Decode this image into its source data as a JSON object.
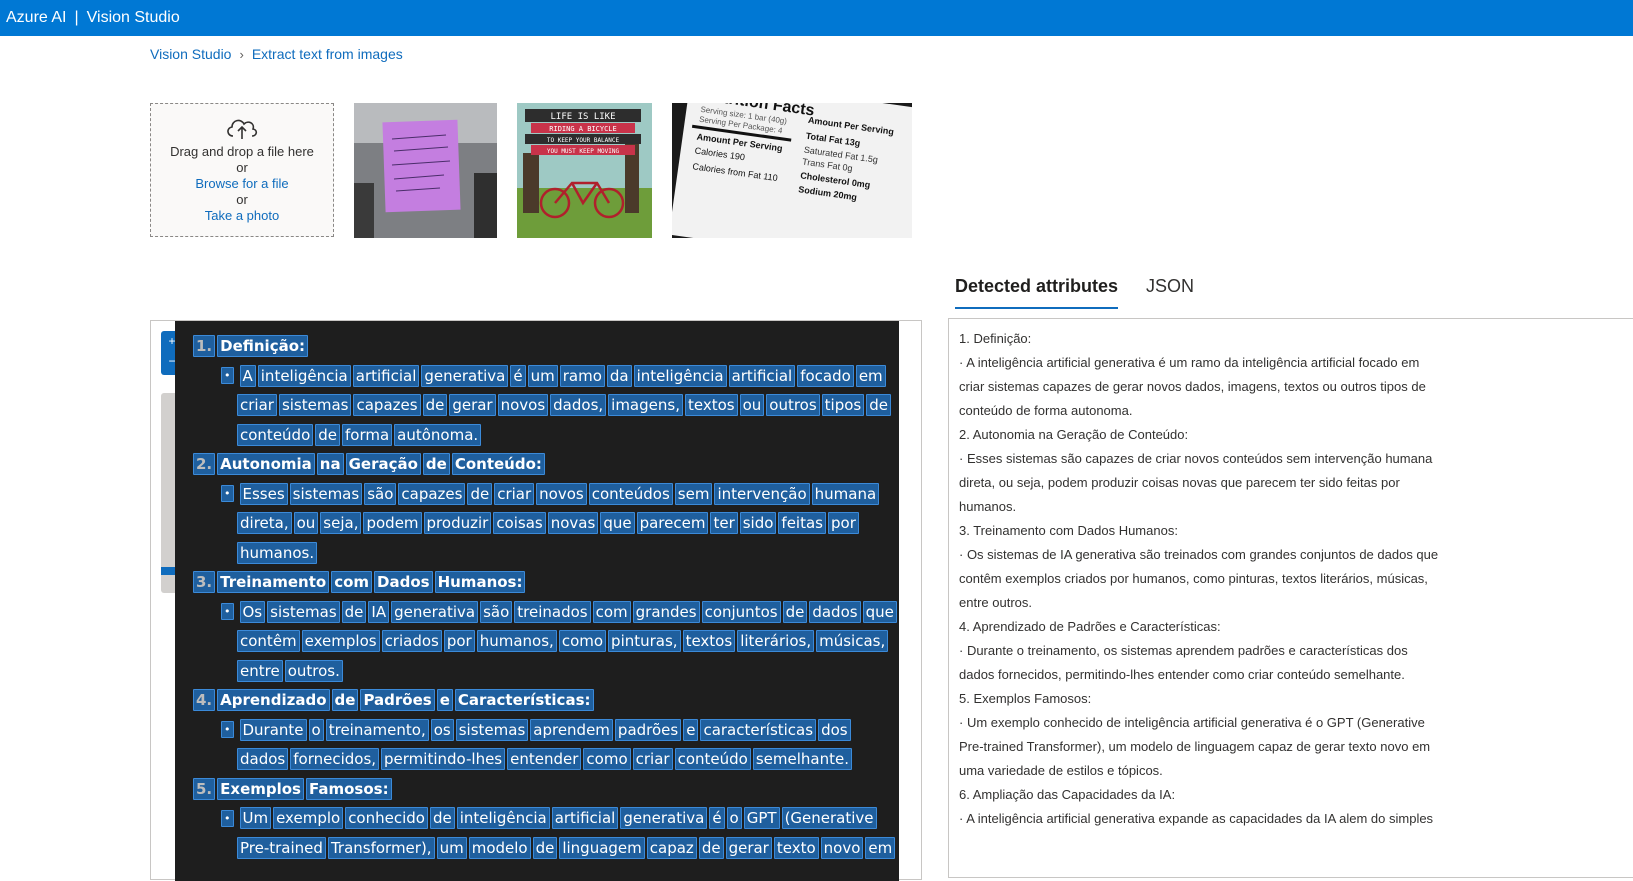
{
  "header": {
    "brand": "Azure AI",
    "separator": "|",
    "product": "Vision Studio"
  },
  "breadcrumb": {
    "items": [
      "Vision Studio",
      "Extract text from images"
    ]
  },
  "upload": {
    "drag_text": "Drag and drop a file here",
    "or1": "or",
    "browse_label": "Browse for a file",
    "or2": "or",
    "photo_label": "Take a photo"
  },
  "samples": {
    "bicycle_lines": [
      "LIFE IS LIKE",
      "RIDING A BICYCLE",
      "TO KEEP YOUR BALANCE",
      "YOU MUST KEEP MOVING"
    ],
    "nutrition_lines": [
      "Nutrition Facts",
      "Serving size: 1 bar (40g)",
      "Serving Per Package: 4",
      "Amount Per Serving",
      "Calories 190",
      "Calories from Fat 110",
      "Total Fat 13g",
      "Saturated Fat 1.5g",
      "Trans Fat 0g",
      "Cholesterol 0mg",
      "Sodium 20mg"
    ]
  },
  "tabs": {
    "detected": "Detected attributes",
    "json": "JSON"
  },
  "viewer": {
    "zoom_in": "+",
    "zoom_out": "−",
    "lines": [
      {
        "type": "heading",
        "num": "1.",
        "words": [
          "Definição:"
        ]
      },
      {
        "type": "bullet",
        "words": [
          "A",
          "inteligência",
          "artificial",
          "generativa",
          "é",
          "um",
          "ramo",
          "da",
          "inteligência",
          "artificial",
          "focado",
          "em"
        ]
      },
      {
        "type": "cont",
        "words": [
          "criar",
          "sistemas",
          "capazes",
          "de",
          "gerar",
          "novos",
          "dados,",
          "imagens,",
          "textos",
          "ou",
          "outros",
          "tipos",
          "de"
        ]
      },
      {
        "type": "cont",
        "words": [
          "conteúdo",
          "de",
          "forma",
          "autônoma."
        ]
      },
      {
        "type": "heading",
        "num": "2.",
        "words": [
          "Autonomia",
          "na",
          "Geração",
          "de",
          "Conteúdo:"
        ]
      },
      {
        "type": "bullet",
        "words": [
          "Esses",
          "sistemas",
          "são",
          "capazes",
          "de",
          "criar",
          "novos",
          "conteúdos",
          "sem",
          "intervenção",
          "humana"
        ]
      },
      {
        "type": "cont",
        "words": [
          "direta,",
          "ou",
          "seja,",
          "podem",
          "produzir",
          "coisas",
          "novas",
          "que",
          "parecem",
          "ter",
          "sido",
          "feitas",
          "por"
        ]
      },
      {
        "type": "cont",
        "words": [
          "humanos."
        ]
      },
      {
        "type": "heading",
        "num": "3.",
        "words": [
          "Treinamento",
          "com",
          "Dados",
          "Humanos:"
        ]
      },
      {
        "type": "bullet",
        "words": [
          "Os",
          "sistemas",
          "de",
          "IA",
          "generativa",
          "são",
          "treinados",
          "com",
          "grandes",
          "conjuntos",
          "de",
          "dados",
          "que"
        ]
      },
      {
        "type": "cont",
        "words": [
          "contêm",
          "exemplos",
          "criados",
          "por",
          "humanos,",
          "como",
          "pinturas,",
          "textos",
          "literários,",
          "músicas,"
        ]
      },
      {
        "type": "cont",
        "words": [
          "entre",
          "outros."
        ]
      },
      {
        "type": "heading",
        "num": "4.",
        "words": [
          "Aprendizado",
          "de",
          "Padrões",
          "e",
          "Características:"
        ]
      },
      {
        "type": "bullet",
        "words": [
          "Durante",
          "o",
          "treinamento,",
          "os",
          "sistemas",
          "aprendem",
          "padrões",
          "e",
          "características",
          "dos"
        ]
      },
      {
        "type": "cont",
        "words": [
          "dados",
          "fornecidos,",
          "permitindo-lhes",
          "entender",
          "como",
          "criar",
          "conteúdo",
          "semelhante."
        ]
      },
      {
        "type": "heading",
        "num": "5.",
        "words": [
          "Exemplos",
          "Famosos:"
        ]
      },
      {
        "type": "bullet",
        "words": [
          "Um",
          "exemplo",
          "conhecido",
          "de",
          "inteligência",
          "artificial",
          "generativa",
          "é",
          "o",
          "GPT",
          "(Generative"
        ]
      },
      {
        "type": "cont",
        "words": [
          "Pre-trained",
          "Transformer),",
          "um",
          "modelo",
          "de",
          "linguagem",
          "capaz",
          "de",
          "gerar",
          "texto",
          "novo",
          "em"
        ]
      }
    ]
  },
  "result_lines": [
    "1. Definição:",
    "· A inteligência artificial generativa é um ramo da inteligência artificial focado em",
    "criar sistemas capazes de gerar novos dados, imagens, textos ou outros tipos de",
    "conteúdo de forma autonoma.",
    "2. Autonomia na Geração de Conteúdo:",
    "· Esses sistemas são capazes de criar novos conteúdos sem intervenção humana",
    "direta, ou seja, podem produzir coisas novas que parecem ter sido feitas por",
    "humanos.",
    "3. Treinamento com Dados Humanos:",
    "· Os sistemas de IA generativa são treinados com grandes conjuntos de dados que",
    "contêm exemplos criados por humanos, como pinturas, textos literários, músicas,",
    "entre outros.",
    "4. Aprendizado de Padrões e Características:",
    "· Durante o treinamento, os sistemas aprendem padrões e características dos",
    "dados fornecidos, permitindo-lhes entender como criar conteúdo semelhante.",
    "5. Exemplos Famosos:",
    "· Um exemplo conhecido de inteligência artificial generativa é o GPT (Generative",
    "Pre-trained Transformer), um modelo de linguagem capaz de gerar texto novo em",
    "uma variedade de estilos e tópicos.",
    "6. Ampliação das Capacidades da IA:",
    "· A inteligência artificial generativa expande as capacidades da IA alem do simples"
  ],
  "colors": {
    "brand": "#0078d4",
    "link": "#0f6cbd",
    "highlight": "#1f5f9e",
    "doc_bg": "#1e1e1e"
  }
}
